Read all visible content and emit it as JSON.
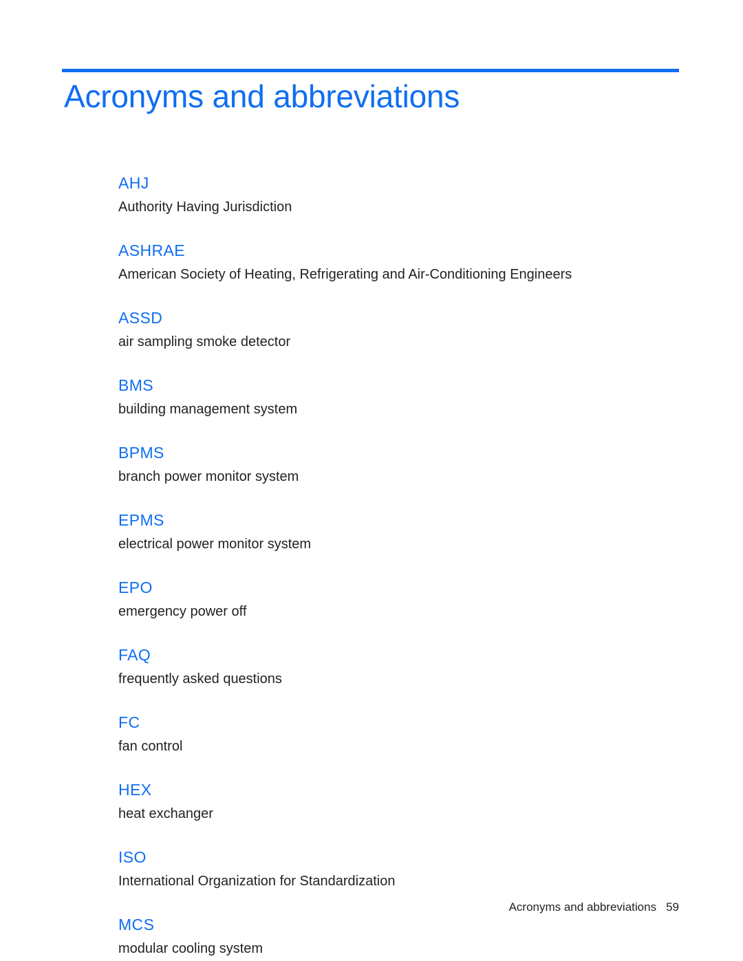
{
  "document": {
    "title": "Acronyms and abbreviations",
    "accent_color": "#0f6ef2",
    "text_color": "#231f20",
    "background_color": "#ffffff"
  },
  "header": {
    "title": "Acronyms and abbreviations"
  },
  "glossary": {
    "entries": [
      {
        "term": "AHJ",
        "definition": "Authority Having Jurisdiction"
      },
      {
        "term": "ASHRAE",
        "definition": "American Society of Heating, Refrigerating and Air-Conditioning Engineers"
      },
      {
        "term": "ASSD",
        "definition": "air sampling smoke detector"
      },
      {
        "term": "BMS",
        "definition": "building management system"
      },
      {
        "term": "BPMS",
        "definition": "branch power monitor system"
      },
      {
        "term": "EPMS",
        "definition": "electrical power monitor system"
      },
      {
        "term": "EPO",
        "definition": "emergency power off"
      },
      {
        "term": "FAQ",
        "definition": "frequently asked questions"
      },
      {
        "term": "FC",
        "definition": "fan control"
      },
      {
        "term": "HEX",
        "definition": "heat exchanger"
      },
      {
        "term": "ISO",
        "definition": "International Organization for Standardization"
      },
      {
        "term": "MCS",
        "definition": "modular cooling system"
      }
    ]
  },
  "footer": {
    "label": "Acronyms and abbreviations",
    "page_number": "59"
  }
}
